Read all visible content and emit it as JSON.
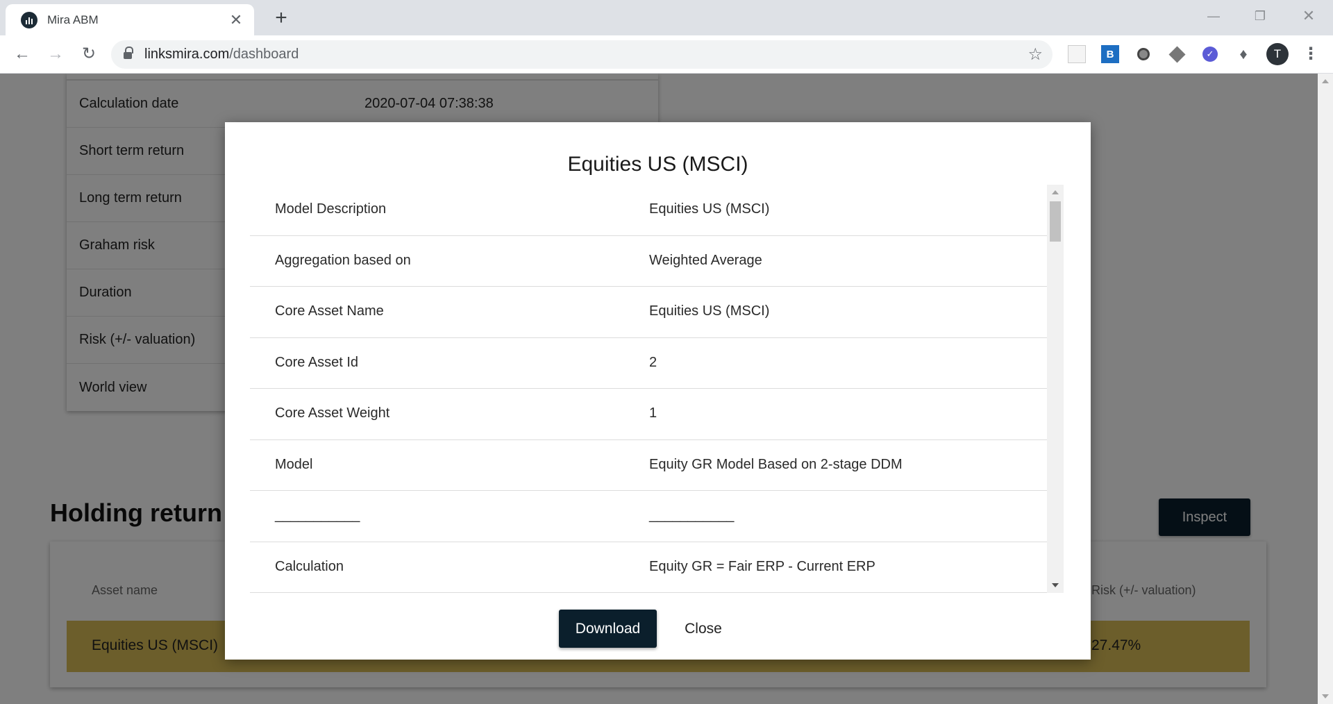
{
  "browser": {
    "tab_title": "Mira ABM",
    "tab_close": "✕",
    "new_tab": "+",
    "url_host": "linksmira.com",
    "url_path": "/dashboard",
    "avatar_letter": "T",
    "icons": [
      "back-arrow",
      "forward-arrow",
      "reload",
      "lock",
      "bookmark-star",
      "extensions-puzzle",
      "menu-kebab"
    ]
  },
  "info_card": {
    "rows": [
      {
        "label": "Calculation date",
        "value": "2020-07-04 07:38:38"
      },
      {
        "label": "Short term return",
        "value": ""
      },
      {
        "label": "Long term return",
        "value": ""
      },
      {
        "label": "Graham risk",
        "value": ""
      },
      {
        "label": "Duration",
        "value": ""
      },
      {
        "label": "Risk (+/- valuation)",
        "value": ""
      },
      {
        "label": "World view",
        "value": ""
      }
    ]
  },
  "holdings": {
    "title": "Holding return",
    "inspect_label": "Inspect",
    "columns": [
      "Asset name",
      "Risk (+/- valuation)"
    ],
    "row": {
      "asset_name": "Equities US (MSCI)",
      "risk": "27.47%"
    },
    "highlight_color": "#d8bd57"
  },
  "modal": {
    "title": "Equities US (MSCI)",
    "rows": [
      {
        "label": "Model Description",
        "value": "Equities US (MSCI)"
      },
      {
        "label": "Aggregation based on",
        "value": "Weighted Average"
      },
      {
        "label": "Core Asset Name",
        "value": "Equities US (MSCI)"
      },
      {
        "label": "Core Asset Id",
        "value": "2"
      },
      {
        "label": "Core Asset Weight",
        "value": "1"
      },
      {
        "label": "Model",
        "value": "Equity GR Model Based on 2-stage DDM"
      },
      {
        "label": "___________",
        "value": "___________"
      },
      {
        "label": "Calculation",
        "value": "Equity GR = Fair ERP - Current ERP"
      }
    ],
    "download_label": "Download",
    "close_label": "Close",
    "button_color": "#0b1f2c"
  }
}
